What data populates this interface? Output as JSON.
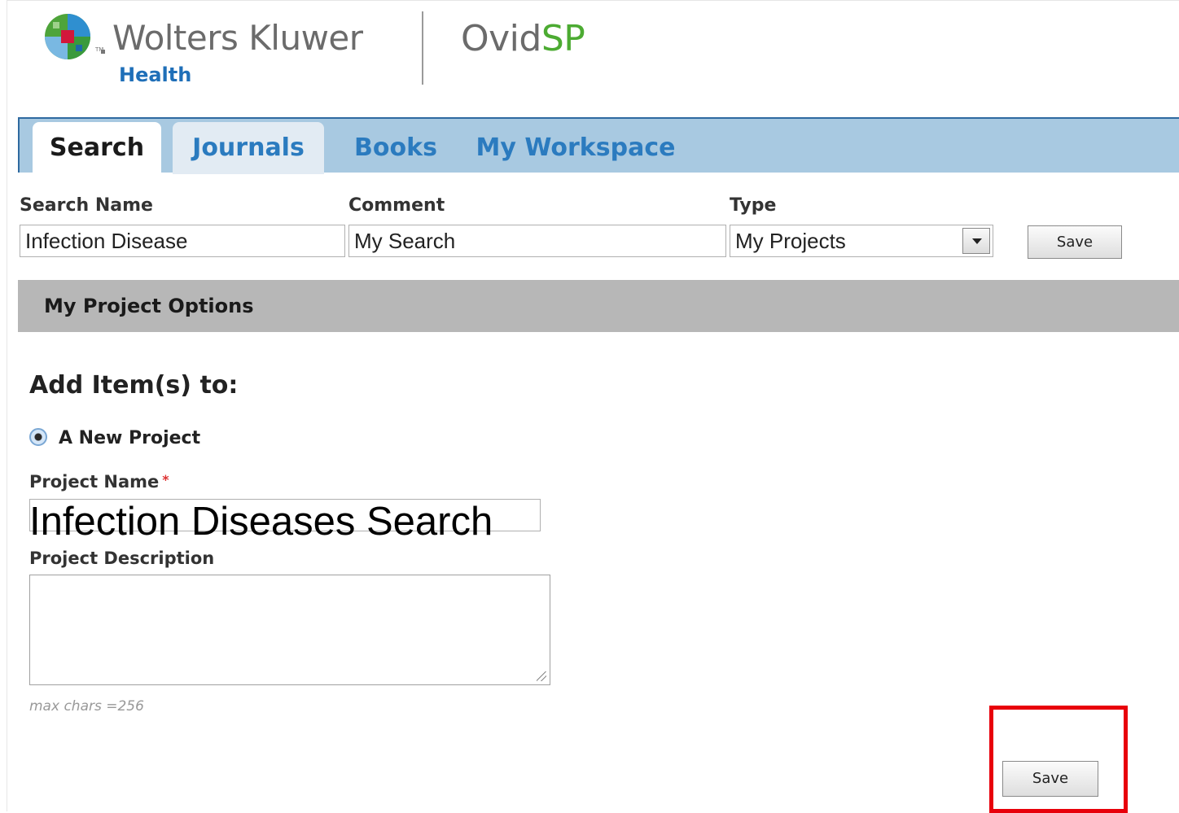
{
  "header": {
    "brand": "Wolters Kluwer",
    "brand_sub": "Health",
    "tm": "TM",
    "product_part1": "Ovid",
    "product_part2": "SP"
  },
  "tabs": [
    {
      "label": "Search",
      "active": true
    },
    {
      "label": "Journals",
      "active": false
    },
    {
      "label": "Books",
      "active": false
    },
    {
      "label": "My Workspace",
      "active": false
    }
  ],
  "search_form": {
    "search_name_label": "Search Name",
    "search_name_value": "Infection Disease",
    "comment_label": "Comment",
    "comment_value": "My Search",
    "type_label": "Type",
    "type_value": "My Projects",
    "save_label": "Save"
  },
  "options": {
    "title": "My Project Options",
    "add_heading": "Add Item(s) to:",
    "new_project_label": "A New Project",
    "new_project_selected": true,
    "project_name_label": "Project Name",
    "required_mark": "*",
    "project_name_value": "Infection Diseases Search",
    "project_description_label": "Project Description",
    "project_description_value": "",
    "max_chars_hint": "max chars =256",
    "save_label": "Save"
  },
  "colors": {
    "tab_bar": "#a8c9e1",
    "tab_text": "#2b7bbf",
    "band": "#b7b7b7",
    "highlight": "#e8000b",
    "brand_green": "#4cab32"
  }
}
